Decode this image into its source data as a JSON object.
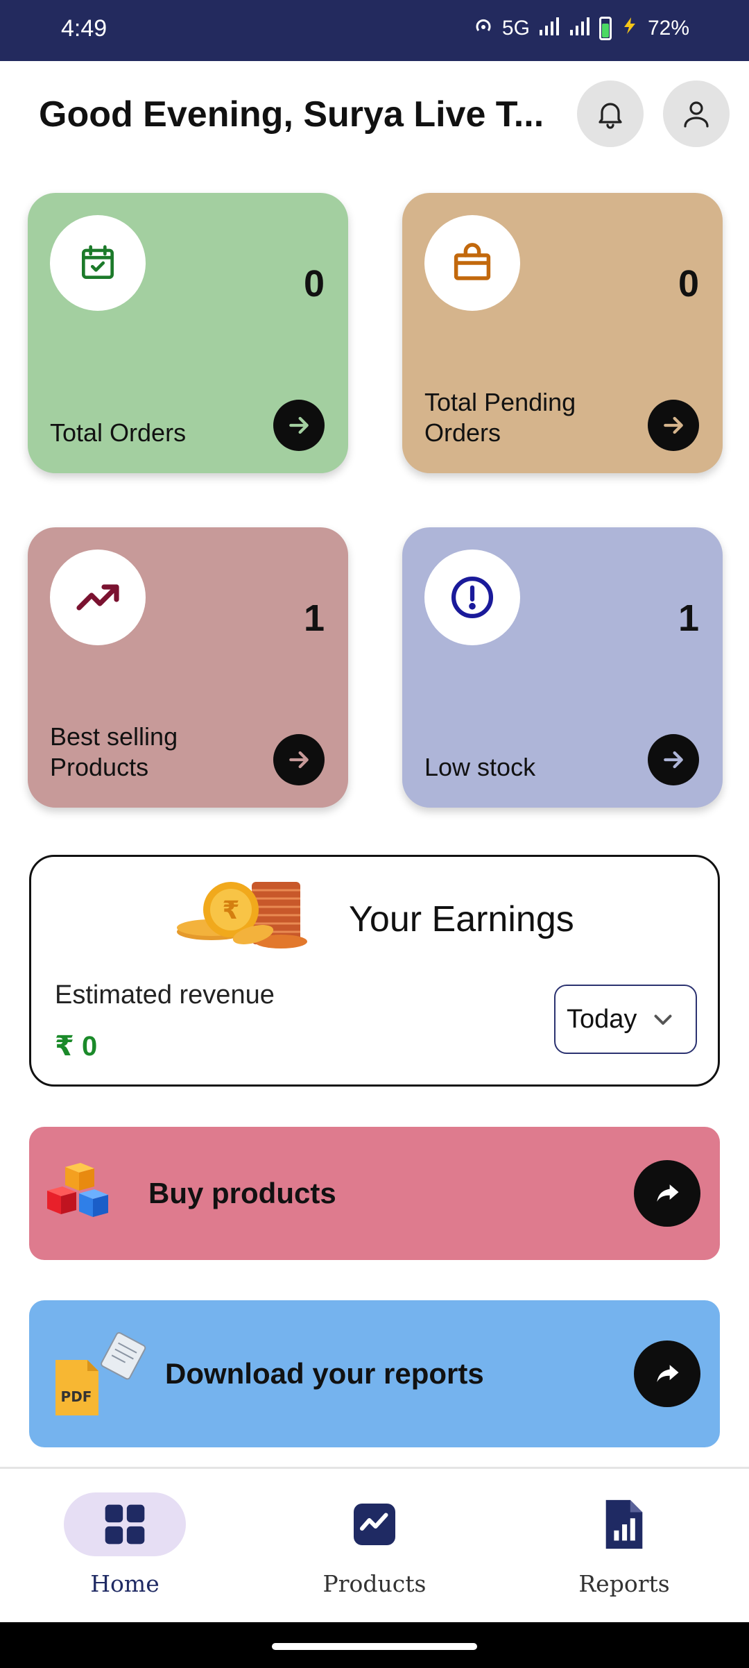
{
  "status_bar": {
    "time": "4:49",
    "network": "5G",
    "battery": "72%"
  },
  "header": {
    "greeting": "Good Evening, Surya Live T..."
  },
  "cards": [
    {
      "label": "Total Orders",
      "count": "0",
      "icon": "calendar-check-icon",
      "color": "#a3cfa0"
    },
    {
      "label": "Total Pending Orders",
      "count": "0",
      "icon": "shopping-bag-icon",
      "color": "#d5b48c"
    },
    {
      "label": "Best selling Products",
      "count": "1",
      "icon": "trending-up-icon",
      "color": "#c79a99"
    },
    {
      "label": "Low stock",
      "count": "1",
      "icon": "alert-circle-icon",
      "color": "#aeb5d8"
    }
  ],
  "earnings": {
    "title": "Your Earnings",
    "subtitle": "Estimated revenue",
    "amount": "₹ 0",
    "period": "Today"
  },
  "actions": [
    {
      "label": "Buy products",
      "color": "#de7b8e"
    },
    {
      "label": "Download your reports",
      "color": "#75b3ee"
    }
  ],
  "bottom_nav": [
    {
      "label": "Home",
      "active": true
    },
    {
      "label": "Products",
      "active": false
    },
    {
      "label": "Reports",
      "active": false
    }
  ],
  "colors": {
    "status_bar": "#232a5e",
    "nav_accent": "#1f2a63",
    "amount_green": "#1b8a2a"
  }
}
